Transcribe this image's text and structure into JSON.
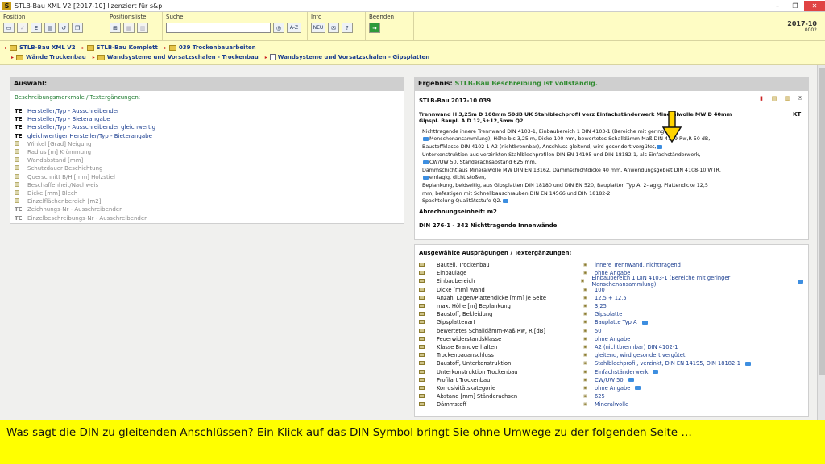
{
  "window": {
    "title": "STLB-Bau XML V2 [2017-10] lizenziert für s&p",
    "app_icon": "S",
    "controls": [
      "–",
      "❐",
      "✕"
    ]
  },
  "toolbar": {
    "groups": [
      {
        "label": "Position"
      },
      {
        "label": "Positionsliste"
      },
      {
        "label": "Suche"
      },
      {
        "label": "Info"
      },
      {
        "label": "Beenden"
      }
    ],
    "search_button": "A-Z",
    "new_button": "NEU",
    "help_button": "?",
    "version": "2017-10",
    "version_sub": "0002"
  },
  "breadcrumb": {
    "line1": [
      "STLB-Bau XML V2",
      "STLB-Bau Komplett",
      "039 Trockenbauarbeiten"
    ],
    "line2": [
      "Wände Trockenbau",
      "Wandsysteme und Vorsatzschalen - Trockenbau",
      "Wandsysteme und Vorsatzschalen - Gipsplatten"
    ]
  },
  "left": {
    "header": "Auswahl:",
    "section_title": "Beschreibungsmerkmale / Textergänzungen:",
    "features": [
      {
        "tag": "TE",
        "label": "Hersteller/Typ - Ausschreibender",
        "active": true
      },
      {
        "tag": "TE",
        "label": "Hersteller/Typ - Bieterangabe",
        "active": true
      },
      {
        "tag": "TE",
        "label": "Hersteller/Typ - Ausschreibender gleichwertig",
        "active": true
      },
      {
        "tag": "TE",
        "label": "gleichwertiger Hersteller/Typ - Bieterangabe",
        "active": true
      },
      {
        "tag": "",
        "label": "Winkel [Grad] Neigung",
        "active": false
      },
      {
        "tag": "",
        "label": "Radius [m] Krümmung",
        "active": false
      },
      {
        "tag": "",
        "label": "Wandabstand [mm]",
        "active": false
      },
      {
        "tag": "",
        "label": "Schutzdauer Beschichtung",
        "active": false
      },
      {
        "tag": "",
        "label": "Querschnitt B/H [mm] Holzstiel",
        "active": false
      },
      {
        "tag": "",
        "label": "Beschaffenheit/Nachweis",
        "active": false
      },
      {
        "tag": "",
        "label": "Dicke [mm] Blech",
        "active": false
      },
      {
        "tag": "",
        "label": "Einzelflächenbereich [m2]",
        "active": false
      },
      {
        "tag": "TE",
        "label": "Zeichnungs-Nr - Ausschreibender",
        "active": false
      },
      {
        "tag": "TE",
        "label": "Einzelbeschreibungs-Nr - Ausschreibender",
        "active": false
      }
    ]
  },
  "right": {
    "header_prefix": "Ergebnis:",
    "header_status": "STLB-Bau Beschreibung ist vollständig.",
    "code": "STLB-Bau 2017-10 039",
    "short_text_1": "Trennwand H 3,25m D 100mm 50dB UK Stahlblechprofil verz Einfachständerwerk Mineralwolle MW D 40mm",
    "short_text_2": "Gipspl. Baupl. A D 12,5+12,5mm Q2",
    "unit_short": "KT",
    "desc_lines": [
      "Nichttragende innere Trennwand DIN 4103-1, Einbaubereich 1 DIN 4103-1 (Bereiche mit geringer",
      "Menschenansammlung), Höhe bis 3,25 m, Dicke 100 mm, bewertetes Schalldämm-Maß DIN 4109 Rw,R 50 dB,",
      "Baustoffklasse DIN 4102-1 A2 (nichtbrennbar), Anschluss gleitend, wird gesondert vergütet,",
      "Unterkonstruktion aus verzinkten Stahlblechprofilen DIN EN 14195 und DIN 18182-1, als Einfachständerwerk,",
      "CW/UW 50, Ständerachsabstand 625 mm,",
      "Dämmschicht aus Mineralwolle MW DIN EN 13162, Dämmschichtdicke 40 mm, Anwendungsgebiet DIN 4108-10 WTR,",
      "einlagig, dicht stoßen,",
      "Beplankung, beidseitig, aus Gipsplatten DIN 18180 und DIN EN 520, Bauplatten Typ A, 2-lagig, Plattendicke 12,5",
      "mm, befestigen mit Schnellbauschrauben DIN EN 14566 und DIN 18182-2,",
      "Spachtelung Qualitätsstufe Q2."
    ],
    "unit_line": "Abrechnungseinheit: m2",
    "din_line": "DIN 276-1 - 342 Nichttragende Innenwände",
    "table_title": "Ausgewählte Ausprägungen / Textergänzungen:",
    "rows": [
      {
        "key": "Bauteil, Trockenbau",
        "value": "innere Trennwand, nichttragend"
      },
      {
        "key": "Einbaulage",
        "value": "ohne Angabe"
      },
      {
        "key": "Einbaubereich",
        "value": "Einbaubereich 1 DIN 4103-1 (Bereiche mit geringer Menschenansammlung)"
      },
      {
        "key": "Dicke [mm] Wand",
        "value": "100"
      },
      {
        "key": "Anzahl Lagen/Plattendicke [mm] je Seite",
        "value": "12,5 + 12,5"
      },
      {
        "key": "max. Höhe [m] Beplankung",
        "value": "3,25"
      },
      {
        "key": "Baustoff, Bekleidung",
        "value": "Gipsplatte"
      },
      {
        "key": "Gipsplattenart",
        "value": "Bauplatte Typ A"
      },
      {
        "key": "bewertetes Schalldämm-Maß Rw, R [dB]",
        "value": "50"
      },
      {
        "key": "Feuerwiderstandsklasse",
        "value": "ohne Angabe"
      },
      {
        "key": "Klasse Brandverhalten",
        "value": "A2 (nichtbrennbar) DIN 4102-1"
      },
      {
        "key": "Trockenbauanschluss",
        "value": "gleitend, wird gesondert vergütet"
      },
      {
        "key": "Baustoff, Unterkonstruktion",
        "value": "Stahlblechprofil, verzinkt, DIN EN 14195, DIN 18182-1"
      },
      {
        "key": "Unterkonstruktion Trockenbau",
        "value": "Einfachständerwerk"
      },
      {
        "key": "Profilart Trockenbau",
        "value": "CW/UW 50"
      },
      {
        "key": "Korrosivitätskategorie",
        "value": "ohne Angabe"
      },
      {
        "key": "Abstand [mm] Ständerachsen",
        "value": "625"
      },
      {
        "key": "Dämmstoff",
        "value": "Mineralwolle"
      }
    ]
  },
  "caption": "Was sagt die DIN zu gleitenden Anschlüssen? Ein Klick auf das DIN Symbol bringt Sie ohne Umwege zu der folgenden Seite …",
  "colors": {
    "toolbar_bg": "#fefcc4",
    "link_blue": "#1a3d8f",
    "status_green": "#2f8a2f",
    "caption_bg": "#ffff00"
  }
}
